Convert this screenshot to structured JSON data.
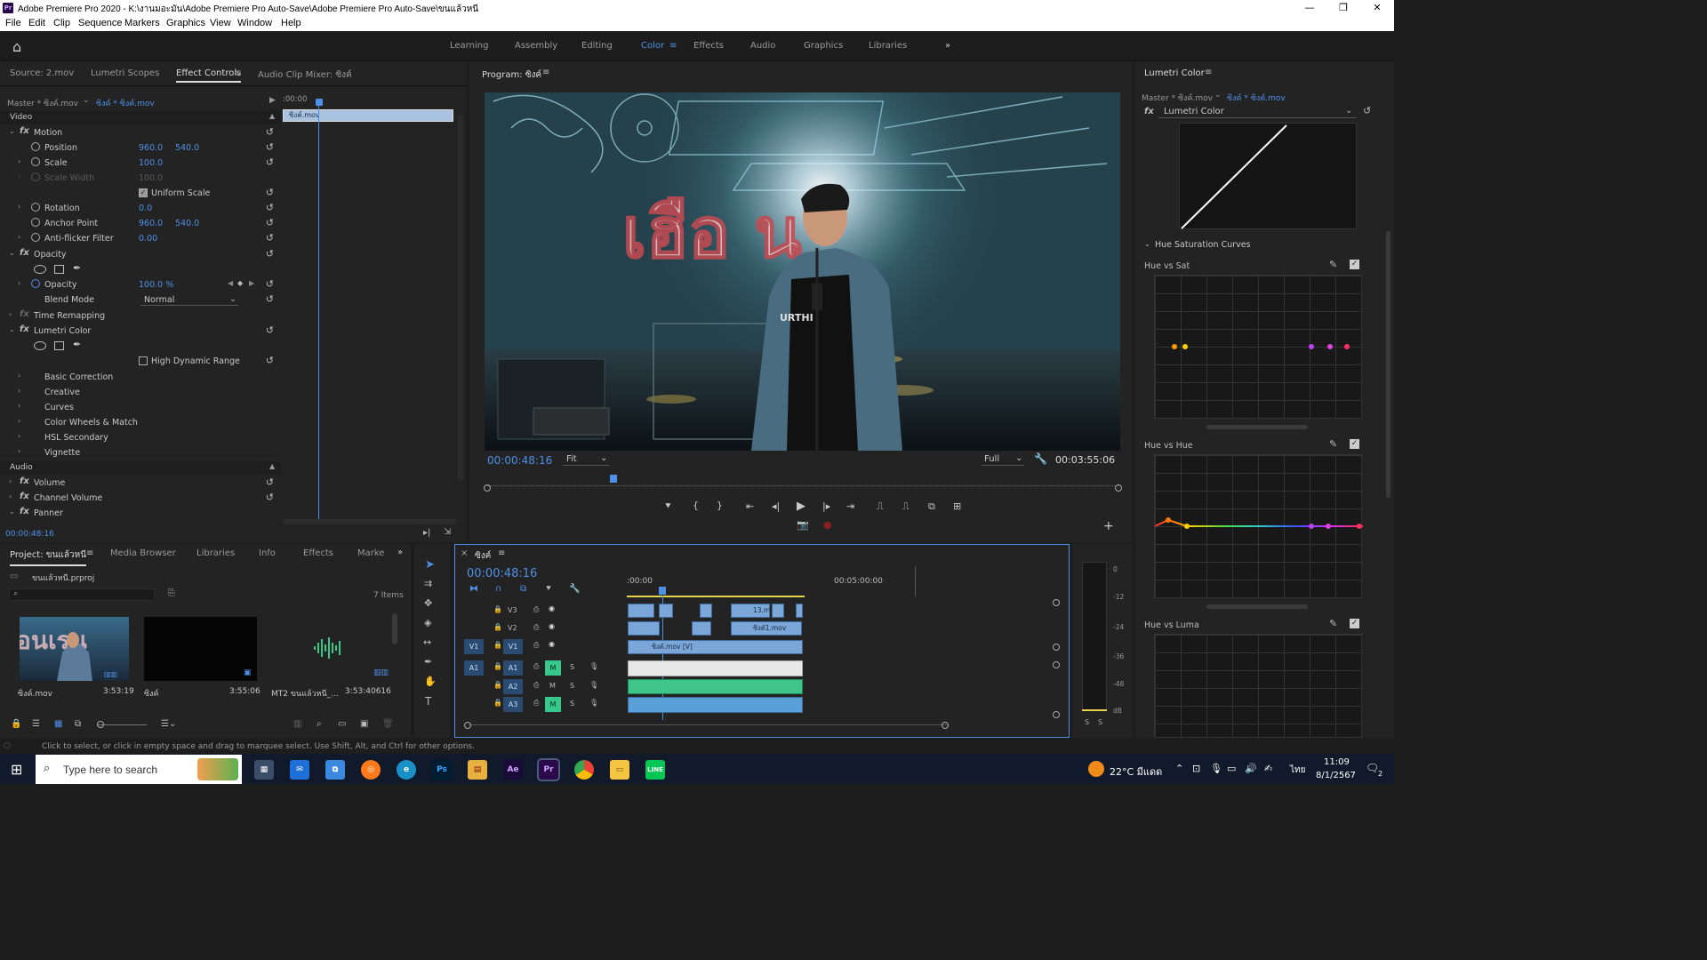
{
  "window": {
    "title": "Adobe Premiere Pro 2020 - K:\\งานมอะมัน\\Adobe Premiere Pro Auto-Save\\Adobe Premiere Pro Auto-Save\\ขนแล้วหนี",
    "logo": "Pr"
  },
  "menu": [
    "File",
    "Edit",
    "Clip",
    "Sequence",
    "Markers",
    "Graphics",
    "View",
    "Window",
    "Help"
  ],
  "workspaces": [
    "Learning",
    "Assembly",
    "Editing",
    "Color",
    "Effects",
    "Audio",
    "Graphics",
    "Libraries"
  ],
  "active_workspace": "Color",
  "effect_panel": {
    "tabs": [
      "Source: 2.mov",
      "Lumetri Scopes",
      "Effect Controls",
      "Audio Clip Mixer: ซิงค์"
    ],
    "master": "Master * ซิงค์.mov",
    "clip": "ซิงค์ * ซิงค์.mov",
    "timecode_top": ":00:00",
    "clip_bar": "ซิงค์.mov",
    "video_label": "Video",
    "audio_label": "Audio",
    "rows": {
      "motion": "Motion",
      "position": "Position",
      "position_x": "960.0",
      "position_y": "540.0",
      "scale": "Scale",
      "scale_v": "100.0",
      "scale_width": "Scale Width",
      "scale_width_v": "100.0",
      "uniform_scale": "Uniform Scale",
      "rotation": "Rotation",
      "rotation_v": "0.0",
      "anchor": "Anchor Point",
      "anchor_x": "960.0",
      "anchor_y": "540.0",
      "antiflicker": "Anti-flicker Filter",
      "antiflicker_v": "0.00",
      "opacity_fx": "Opacity",
      "opacity": "Opacity",
      "opacity_v": "100.0 %",
      "blend": "Blend Mode",
      "blend_v": "Normal",
      "time_remap": "Time Remapping",
      "lumetri": "Lumetri Color",
      "hdr": "High Dynamic Range",
      "basic": "Basic Correction",
      "creative": "Creative",
      "curves": "Curves",
      "wheels": "Color Wheels & Match",
      "hsl": "HSL Secondary",
      "vignette": "Vignette",
      "volume": "Volume",
      "channel_volume": "Channel Volume",
      "panner": "Panner"
    },
    "timecode_bottom": "00:00:48:16"
  },
  "program": {
    "title": "Program: ซิงค์",
    "timecode": "00:00:48:16",
    "fit": "Fit",
    "quality": "Full",
    "duration": "00:03:55:06",
    "overlay_thai": "เฮือ   น",
    "shirt": "URTHI"
  },
  "project": {
    "tabs": [
      "Project: ขนแล้วหนี",
      "Media Browser",
      "Libraries",
      "Info",
      "Effects",
      "Marke"
    ],
    "file": "ขนแล้วหนี.prproj",
    "items_count": "7 Items",
    "items": [
      {
        "name": "ซิงค์.mov",
        "duration": "3:53:19"
      },
      {
        "name": "ซิงค์",
        "duration": "3:55:06"
      },
      {
        "name": "MT2 ขนแล้วหนี_...",
        "duration": "3:53:40616"
      }
    ]
  },
  "timeline": {
    "title": "ซิงค์",
    "timecode": "00:00:48:16",
    "ruler_start": ":00:00",
    "ruler_mid": "00:05:00:00",
    "tracks": [
      "V3",
      "V2",
      "V1",
      "A1",
      "A2",
      "A3"
    ],
    "clip_v3": "13.m",
    "clip_v2": "ซิงค์1.mov",
    "clip_v1": "ซิงค์.mov [V]",
    "meter_labels": [
      "0",
      "-12",
      "-24",
      "-36",
      "-48",
      "dB"
    ],
    "solo": "S"
  },
  "lumetri": {
    "title": "Lumetri Color",
    "master": "Master * ซิงค์.mov",
    "clip": "ซิงค์ * ซิงค์.mov",
    "effect": "Lumetri Color",
    "section": "Hue Saturation Curves",
    "curves": [
      "Hue vs Sat",
      "Hue vs Hue",
      "Hue vs Luma"
    ]
  },
  "status": "Click to select, or click in empty space and drag to marquee select. Use Shift, Alt, and Ctrl for other options.",
  "taskbar": {
    "search": "Type here to search",
    "weather": "22°C มีแดด",
    "time": "11:09",
    "date": "8/1/2567",
    "lang": "ไทย",
    "notif": "2"
  }
}
